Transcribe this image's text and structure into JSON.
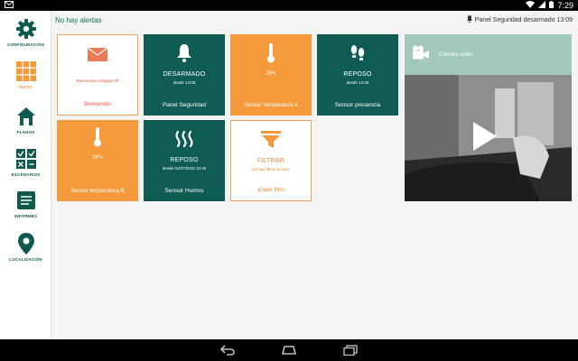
{
  "statusbar": {
    "time": "7:29"
  },
  "sidebar": {
    "items": [
      {
        "label": "CONFIGURACIÓN"
      },
      {
        "label": "INICIO"
      },
      {
        "label": "PLANOS"
      },
      {
        "label": "ESCENARIOS"
      },
      {
        "label": "INFORMES"
      },
      {
        "label": "LOCALIZACIÓN"
      }
    ]
  },
  "topbar": {
    "alert": "No hay alertas",
    "panel_status": "Panel Seguridad desarmado 13:09"
  },
  "tiles": {
    "welcome": {
      "sub": "Bienvenido a Mygal Off",
      "label": "Bienvenido"
    },
    "panel": {
      "title": "DESARMADO",
      "sub": "desde 13:08",
      "label": "Panel Seguridad"
    },
    "temp_a": {
      "value": "29ºc",
      "label": "Sensor Temperatura A"
    },
    "presence": {
      "title": "REPOSO",
      "sub": "desde 13:29",
      "label": "Sensor presencia"
    },
    "temp_b": {
      "value": "29ºc",
      "label": "Sensor temperatura B"
    },
    "smoke": {
      "title": "REPOSO",
      "sub": "desde 01/07/2015 13:49",
      "label": "Sensor Humos"
    },
    "filter": {
      "title": "FILTRAR",
      "sub": "No hay filtros activos",
      "label": "añadir filtro"
    }
  },
  "camera": {
    "label": "Cámara vídeo"
  },
  "colors": {
    "teal": "#0f5c54",
    "orange": "#f59a3b",
    "camera_header": "#a2c8be"
  }
}
